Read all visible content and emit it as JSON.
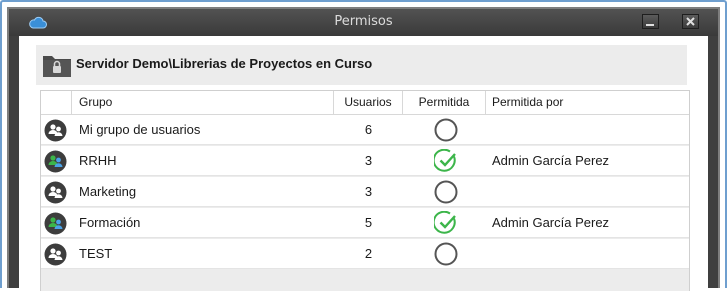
{
  "window": {
    "title": "Permisos",
    "accent_color": "#6f9fcf"
  },
  "header": {
    "path": "Servidor Demo\\Librerias de Proyectos en Curso",
    "icon": "locked-folder-icon"
  },
  "table": {
    "columns": [
      "Grupo",
      "Usuarios",
      "Permitida",
      "Permitida por"
    ],
    "rows": [
      {
        "group": "Mi grupo de usuarios",
        "users": "6",
        "allowed": false,
        "allowed_by": "",
        "icon": "group-icon"
      },
      {
        "group": "RRHH",
        "users": "3",
        "allowed": true,
        "allowed_by": "Admin García Perez",
        "icon": "group-icon-active"
      },
      {
        "group": "Marketing",
        "users": "3",
        "allowed": false,
        "allowed_by": "",
        "icon": "group-icon"
      },
      {
        "group": "Formación",
        "users": "5",
        "allowed": true,
        "allowed_by": "Admin García Perez",
        "icon": "group-icon-active"
      },
      {
        "group": "TEST",
        "users": "2",
        "allowed": false,
        "allowed_by": "",
        "icon": "group-icon"
      }
    ],
    "check_color": "#3cb54a"
  }
}
